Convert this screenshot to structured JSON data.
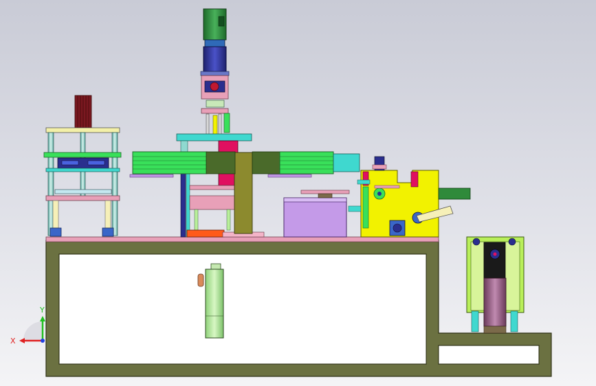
{
  "viewport": {
    "background_top": "#c9cbd6",
    "background_bottom": "#f4f4f6"
  },
  "colors": {
    "frame": "#6b7141",
    "frame_stroke": "#2e3116",
    "table_top": "#e8a0b8",
    "bright_green": "#39e05a",
    "lime_yellow": "#f2f200",
    "lavender": "#c49ae8",
    "pink": "#ff6fa0",
    "magenta": "#e01060",
    "navy": "#2a2e8e",
    "motor_green": "#2f8a3a",
    "olive": "#8c8a2e",
    "steel_blue": "#3a66c8",
    "light_green": "#b9ef9a",
    "dark_red": "#7a1820",
    "cyan": "#3fd8cf",
    "brown": "#7b6a4a"
  },
  "triad": {
    "x_label": "X",
    "y_label": "Y",
    "x_color": "#e02020",
    "y_color": "#20c020",
    "z_color": "#2040e0"
  }
}
